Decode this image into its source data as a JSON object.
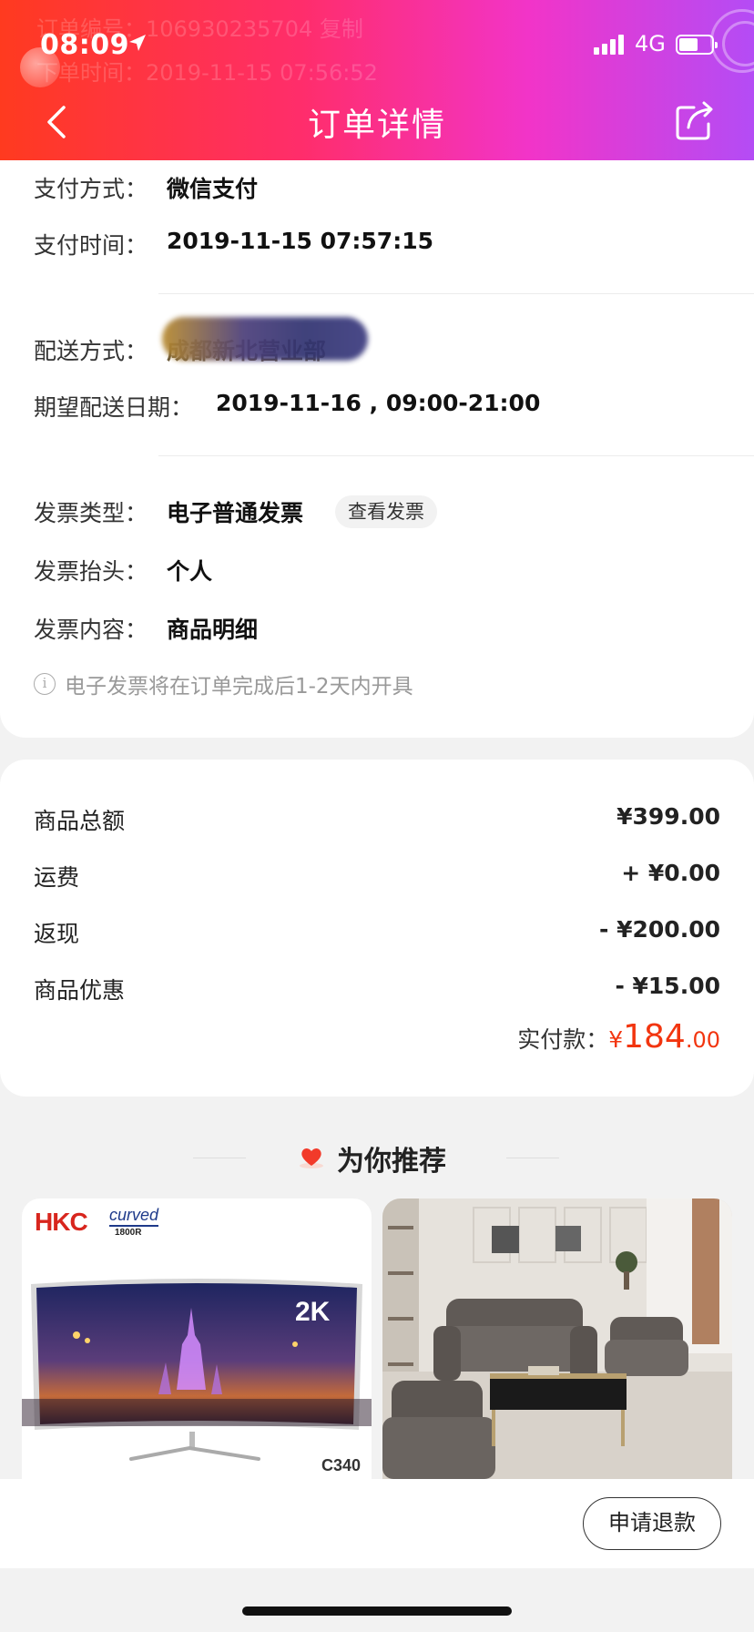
{
  "status_bar": {
    "time": "08:09",
    "network": "4G"
  },
  "header": {
    "title": "订单详情",
    "ghost_lines": [
      "订单编号：106930235704 复制",
      "下单时间：2019-11-15 07:56:52"
    ]
  },
  "order_info": {
    "pay_method_label": "支付方式：",
    "pay_method": "微信支付",
    "pay_time_label": "支付时间：",
    "pay_time": "2019-11-15 07:57:15",
    "delivery_label": "配送方式：",
    "delivery_value": "成都新北营业部",
    "expected_date_label": "期望配送日期：",
    "expected_date": "2019-11-16 , 09:00-21:00",
    "invoice_type_label": "发票类型：",
    "invoice_type": "电子普通发票",
    "view_invoice": "查看发票",
    "invoice_title_label": "发票抬头：",
    "invoice_title": "个人",
    "invoice_content_label": "发票内容：",
    "invoice_content": "商品明细",
    "note": "电子发票将在订单完成后1-2天内开具"
  },
  "price": {
    "rows": [
      {
        "label": "商品总额",
        "value": "¥399.00"
      },
      {
        "label": "运费",
        "value": "+ ¥0.00"
      },
      {
        "label": "返现",
        "value": "- ¥200.00"
      },
      {
        "label": "商品优惠",
        "value": "- ¥15.00"
      }
    ],
    "paid_label": "实付款：",
    "paid_currency": "¥",
    "paid_int": "184",
    "paid_dec": ".00",
    "accent_color": "#f2350f"
  },
  "recommend": {
    "title": "为你推荐",
    "products": [
      {
        "brand": "HKC",
        "badge": "curved",
        "badge_sub": "1800R",
        "res": "2K",
        "model": "C340"
      },
      {
        "image": "office sofa set"
      }
    ]
  },
  "footer": {
    "refund_button": "申请退款"
  },
  "colors": {
    "header_start": "#ff3a1f",
    "header_end": "#b44cf5"
  }
}
